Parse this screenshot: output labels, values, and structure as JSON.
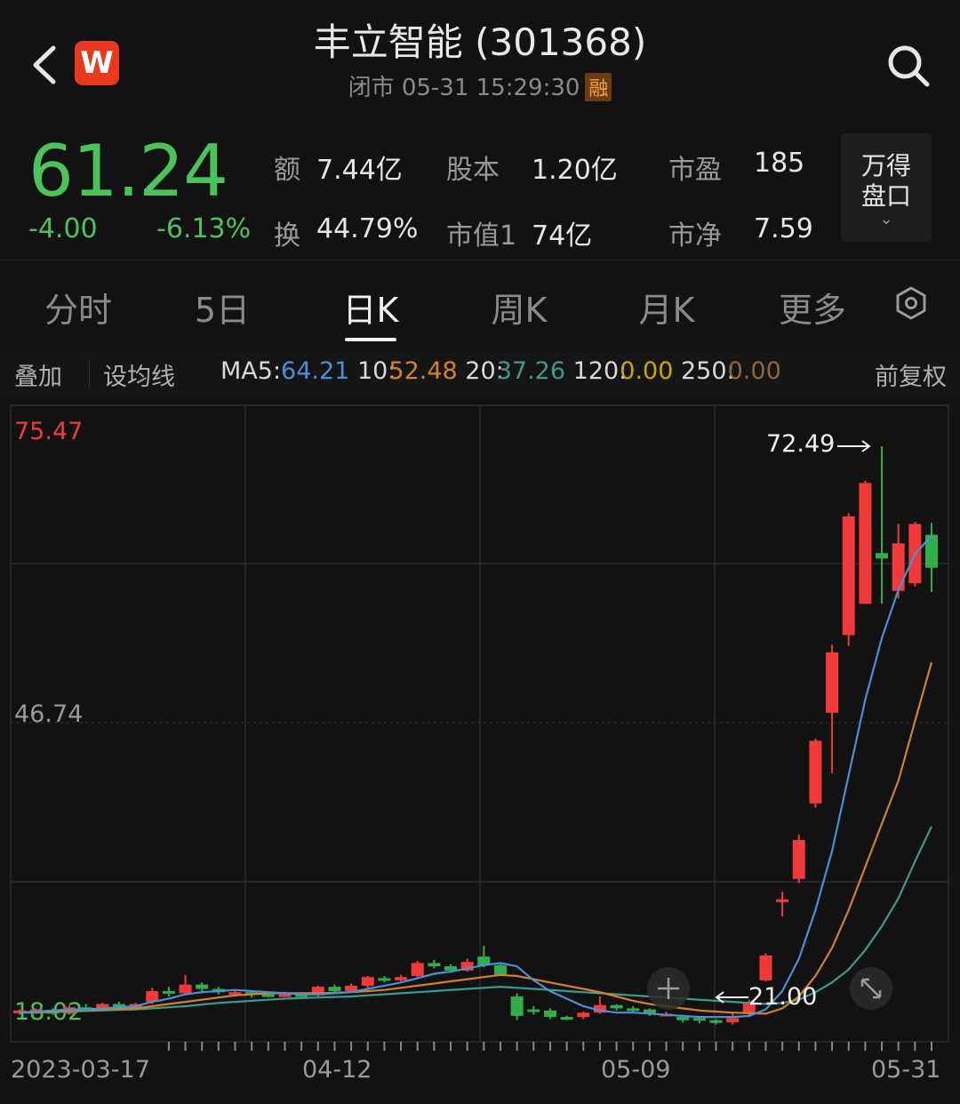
{
  "header": {
    "title": "丰立智能 (301368)",
    "status": "闭市 05-31 15:29:30",
    "badge": "融",
    "logo_letter": "W"
  },
  "quote": {
    "price": "61.24",
    "change": "-4.00",
    "change_pct": "-6.13%",
    "rows": [
      [
        {
          "label": "额",
          "value": "7.44亿"
        },
        {
          "label": "股本",
          "value": "1.20亿"
        },
        {
          "label": "市盈",
          "value": "185"
        }
      ],
      [
        {
          "label": "换",
          "value": "44.79%"
        },
        {
          "label": "市值1",
          "value": "74亿"
        },
        {
          "label": "市净",
          "value": "7.59"
        }
      ]
    ],
    "wind_button": "万得盘口"
  },
  "tabs": [
    "分时",
    "5日",
    "日K",
    "周K",
    "月K",
    "更多"
  ],
  "active_tab": "日K",
  "ma_bar": {
    "overlay": "叠加",
    "settings": "设均线",
    "ma5_label": "MA5:",
    "ma5_value": "64.21",
    "ma10_label": "10:",
    "ma10_value": "52.48",
    "ma20_label": "20:",
    "ma20_value": "37.26",
    "ma120_label": "120:",
    "ma120_value": "0.00",
    "ma250_label": "250:",
    "ma250_value": "0.00",
    "adjust": "前复权"
  },
  "colors": {
    "up": "#f23a3a",
    "down": "#2fae4a",
    "ma5": "#4a90d9",
    "ma10": "#d4822a",
    "ma20": "#3d9a8a",
    "price_green": "#4cc35a"
  },
  "chart_data": {
    "type": "candlestick",
    "y_labels": [
      "75.47",
      "46.74",
      "18.02"
    ],
    "ylim": [
      18.02,
      75.47
    ],
    "x_labels": [
      "2023-03-17",
      "04-12",
      "05-09",
      "05-31"
    ],
    "max_annotation": "72.49",
    "min_annotation": "21.00",
    "candles": [
      [
        20.0,
        20.2,
        20.3,
        19.8
      ],
      [
        20.1,
        20.3,
        20.4,
        19.9
      ],
      [
        20.2,
        19.9,
        20.4,
        19.8
      ],
      [
        19.9,
        20.5,
        20.7,
        19.8
      ],
      [
        20.5,
        20.3,
        20.8,
        20.2
      ],
      [
        20.3,
        20.8,
        20.9,
        20.2
      ],
      [
        20.8,
        20.4,
        21.0,
        20.3
      ],
      [
        20.4,
        20.8,
        20.9,
        20.3
      ],
      [
        21.0,
        22.0,
        22.3,
        20.8
      ],
      [
        22.0,
        21.8,
        22.4,
        21.5
      ],
      [
        21.8,
        22.6,
        23.5,
        21.6
      ],
      [
        22.6,
        22.2,
        22.8,
        21.9
      ],
      [
        22.2,
        21.9,
        22.4,
        21.7
      ],
      [
        21.9,
        21.9,
        22.1,
        21.5
      ],
      [
        21.9,
        21.7,
        22.0,
        21.4
      ],
      [
        21.7,
        21.6,
        21.9,
        21.4
      ],
      [
        21.6,
        21.7,
        21.9,
        21.5
      ],
      [
        21.7,
        21.5,
        21.8,
        21.3
      ],
      [
        21.6,
        22.4,
        22.5,
        21.5
      ],
      [
        22.4,
        22.0,
        22.6,
        21.9
      ],
      [
        22.0,
        22.5,
        22.7,
        21.9
      ],
      [
        22.5,
        23.3,
        23.4,
        22.3
      ],
      [
        23.2,
        23.0,
        23.4,
        22.8
      ],
      [
        23.0,
        23.3,
        23.5,
        22.9
      ],
      [
        23.4,
        24.6,
        24.8,
        23.3
      ],
      [
        24.6,
        24.3,
        24.9,
        24.1
      ],
      [
        24.3,
        23.9,
        24.5,
        23.7
      ],
      [
        23.9,
        24.7,
        25.0,
        23.8
      ],
      [
        25.2,
        24.4,
        26.2,
        24.2
      ],
      [
        24.4,
        23.5,
        24.6,
        23.4
      ],
      [
        21.5,
        19.7,
        21.8,
        19.3
      ],
      [
        20.3,
        20.2,
        20.6,
        19.8
      ],
      [
        20.2,
        19.6,
        20.4,
        19.4
      ],
      [
        19.6,
        19.5,
        19.7,
        19.3
      ],
      [
        19.6,
        20.0,
        20.1,
        19.4
      ],
      [
        20.0,
        20.7,
        21.5,
        19.9
      ],
      [
        20.7,
        20.4,
        20.8,
        20.2
      ],
      [
        20.4,
        20.3,
        20.6,
        20.1
      ],
      [
        20.3,
        19.9,
        20.4,
        19.7
      ],
      [
        19.9,
        19.9,
        20.1,
        19.7
      ],
      [
        19.6,
        19.3,
        19.8,
        19.1
      ],
      [
        19.5,
        19.3,
        19.6,
        19.0
      ],
      [
        19.3,
        19.1,
        19.4,
        18.9
      ],
      [
        19.1,
        19.5,
        20.0,
        18.9
      ],
      [
        20.0,
        21.0,
        21.2,
        19.6
      ],
      [
        23.0,
        25.3,
        25.5,
        22.9
      ],
      [
        30.4,
        30.5,
        31.2,
        28.9
      ],
      [
        32.4,
        36.0,
        36.5,
        32.0
      ],
      [
        39.4,
        45.2,
        45.4,
        39.0
      ],
      [
        47.8,
        53.4,
        54.1,
        42.2
      ],
      [
        55.0,
        66.0,
        66.3,
        54.0
      ],
      [
        57.9,
        69.1,
        69.3,
        57.9
      ],
      [
        62.6,
        62.1,
        72.49,
        57.9
      ],
      [
        59.1,
        63.5,
        65.3,
        58.4
      ],
      [
        59.8,
        65.3,
        65.5,
        59.5
      ],
      [
        64.3,
        61.24,
        65.4,
        59.0
      ]
    ],
    "ma5": [
      20.0,
      20.1,
      20.2,
      20.3,
      20.3,
      20.4,
      20.5,
      20.6,
      21.0,
      21.3,
      21.7,
      21.9,
      22.0,
      22.1,
      22.0,
      21.9,
      21.8,
      21.7,
      21.7,
      21.8,
      21.9,
      22.2,
      22.5,
      22.8,
      23.2,
      23.6,
      23.8,
      24.1,
      24.4,
      24.6,
      24.3,
      23.0,
      22.0,
      21.3,
      20.6,
      20.2,
      20.0,
      20.0,
      19.9,
      19.8,
      19.7,
      19.6,
      19.6,
      19.6,
      19.7,
      20.3,
      22.0,
      25.0,
      29.5,
      35.0,
      42.0,
      49.0,
      54.7,
      59.2,
      62.5,
      64.21
    ],
    "ma10": [
      20.0,
      20.05,
      20.1,
      20.2,
      20.25,
      20.3,
      20.35,
      20.4,
      20.6,
      20.8,
      21.0,
      21.2,
      21.4,
      21.6,
      21.7,
      21.8,
      21.8,
      21.8,
      21.8,
      21.85,
      21.9,
      22.0,
      22.1,
      22.3,
      22.5,
      22.7,
      22.9,
      23.1,
      23.3,
      23.5,
      23.4,
      23.1,
      22.8,
      22.5,
      22.2,
      21.9,
      21.5,
      21.1,
      20.8,
      20.6,
      20.4,
      20.2,
      20.1,
      20.0,
      19.95,
      19.9,
      20.4,
      21.5,
      23.4,
      26.0,
      29.5,
      33.5,
      37.5,
      41.5,
      47.0,
      52.48
    ],
    "ma20": [
      20.0,
      20.0,
      20.05,
      20.1,
      20.15,
      20.2,
      20.25,
      20.3,
      20.4,
      20.5,
      20.6,
      20.75,
      20.9,
      21.0,
      21.1,
      21.2,
      21.3,
      21.35,
      21.4,
      21.45,
      21.5,
      21.6,
      21.7,
      21.8,
      21.9,
      22.0,
      22.1,
      22.2,
      22.3,
      22.4,
      22.3,
      22.2,
      22.1,
      22.0,
      21.9,
      21.8,
      21.7,
      21.6,
      21.5,
      21.4,
      21.3,
      21.2,
      21.1,
      21.0,
      20.9,
      20.8,
      20.9,
      21.2,
      21.9,
      22.8,
      24.0,
      25.8,
      28.0,
      30.6,
      34.0,
      37.26
    ]
  }
}
